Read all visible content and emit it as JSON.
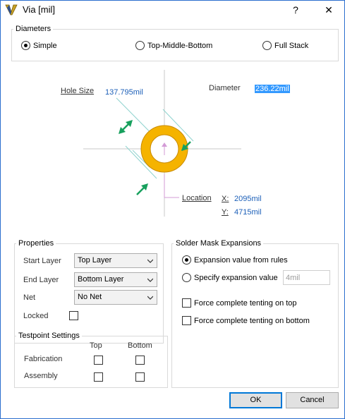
{
  "window": {
    "title": "Via [mil]",
    "help": "?",
    "close": "✕"
  },
  "diameters": {
    "legend": "Diameters",
    "options": [
      {
        "label": "Simple",
        "selected": true
      },
      {
        "label": "Top-Middle-Bottom",
        "selected": false
      },
      {
        "label": "Full Stack",
        "selected": false
      }
    ]
  },
  "diagram": {
    "hole_size_label": "Hole Size",
    "hole_size_value": "137.795mil",
    "diameter_label": "Diameter",
    "diameter_value": "236.22mil",
    "location_label": "Location",
    "x_label": "X:",
    "x_value": "2095mil",
    "y_label": "Y:",
    "y_value": "4715mil",
    "pad_color": "#f5b300",
    "arrow_color": "#17a05d"
  },
  "properties": {
    "legend": "Properties",
    "start_layer_label": "Start Layer",
    "start_layer_value": "Top Layer",
    "end_layer_label": "End Layer",
    "end_layer_value": "Bottom Layer",
    "net_label": "Net",
    "net_value": "No Net",
    "locked_label": "Locked",
    "locked": false
  },
  "testpoint": {
    "legend": "Testpoint Settings",
    "col_top": "Top",
    "col_bottom": "Bottom",
    "row_fabrication": "Fabrication",
    "row_assembly": "Assembly"
  },
  "solder_mask": {
    "legend": "Solder Mask Expansions",
    "option_rules": "Expansion value from rules",
    "option_specify": "Specify expansion value",
    "specify_value": "4mil",
    "tent_top": "Force complete tenting on top",
    "tent_bottom": "Force complete tenting on bottom"
  },
  "buttons": {
    "ok": "OK",
    "cancel": "Cancel"
  }
}
